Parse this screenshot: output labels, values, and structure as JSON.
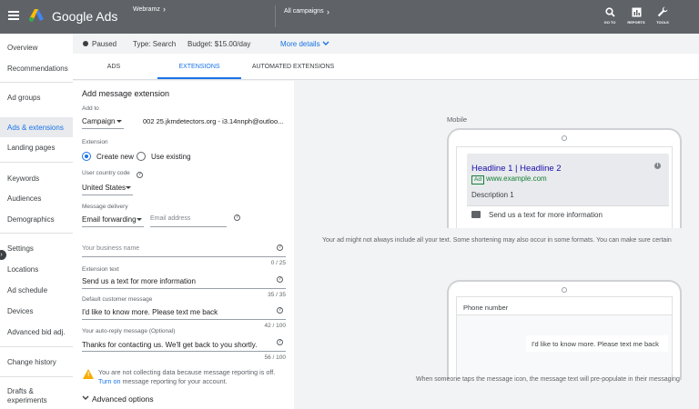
{
  "topbar": {
    "brand": "Google Ads",
    "account_name": "Webramz",
    "campaign_crumb": "All campaigns",
    "tools": [
      {
        "label": "GO TO",
        "icon": "search-icon"
      },
      {
        "label": "REPORTS",
        "icon": "reports-icon"
      },
      {
        "label": "TOOLS",
        "icon": "wrench-icon"
      }
    ]
  },
  "nav": {
    "items": [
      "Overview",
      "Recommendations",
      "Ad groups",
      "Ads & extensions",
      "Landing pages",
      "Keywords",
      "Audiences",
      "Demographics",
      "Settings",
      "Locations",
      "Ad schedule",
      "Devices",
      "Advanced bid adj.",
      "Change history",
      "Drafts & experiments"
    ]
  },
  "status": {
    "state": "Paused",
    "type": "Type: Search",
    "budget": "Budget: $15.00/day",
    "more_details": "More details"
  },
  "tabs": [
    "ADS",
    "EXTENSIONS",
    "AUTOMATED EXTENSIONS"
  ],
  "form": {
    "title": "Add message extension",
    "add_to_label": "Add to",
    "add_to_value": "Campaign",
    "campaign_name": "002 25.jkmdetectors.org - i3.14nnph@outloo...",
    "extension_label": "Extension",
    "create_new": "Create new",
    "use_existing": "Use existing",
    "country_code_label": "User country code",
    "country_value": "United States",
    "delivery_label": "Message delivery",
    "delivery_value": "Email forwarding",
    "email_placeholder": "Email address",
    "business_name_placeholder": "Your business name",
    "business_counter": "0 / 25",
    "ext_text_label": "Extension text",
    "ext_text_value": "Send us a text for more information",
    "ext_text_counter": "35 / 35",
    "default_msg_label": "Default customer message",
    "default_msg_value": "I'd like to know more. Please text me back",
    "default_msg_counter": "42 / 100",
    "auto_reply_label": "Your auto-reply message (Optional)",
    "auto_reply_value": "Thanks for contacting us. We'll get back to you shortly.",
    "auto_reply_counter": "56 / 100",
    "warning_text": "You are not collecting data because message reporting is off.",
    "warning_link": "Turn on",
    "warning_rest": "message reporting for your account.",
    "advanced": "Advanced options"
  },
  "preview": {
    "mobile_label": "Mobile",
    "headline": "Headline 1 | Headline 2",
    "ad_badge": "Ad",
    "display_url": "www.example.com",
    "description": "Description 1",
    "message_text": "Send us a text for more information",
    "caption_1": "Your ad might not always include all your text. Some shortening may also occur in some formats. You can make sure certain",
    "phone_number_label": "Phone number",
    "bubble_text": "I'd like to know more. Please text me back",
    "caption_2": "When someone taps the message icon, the message text will pre-populate in their messaging"
  },
  "colors": {
    "accent": "#1a73e8",
    "topbar": "#5f6368",
    "warning": "#f9ab00",
    "ad_green": "#188038"
  }
}
